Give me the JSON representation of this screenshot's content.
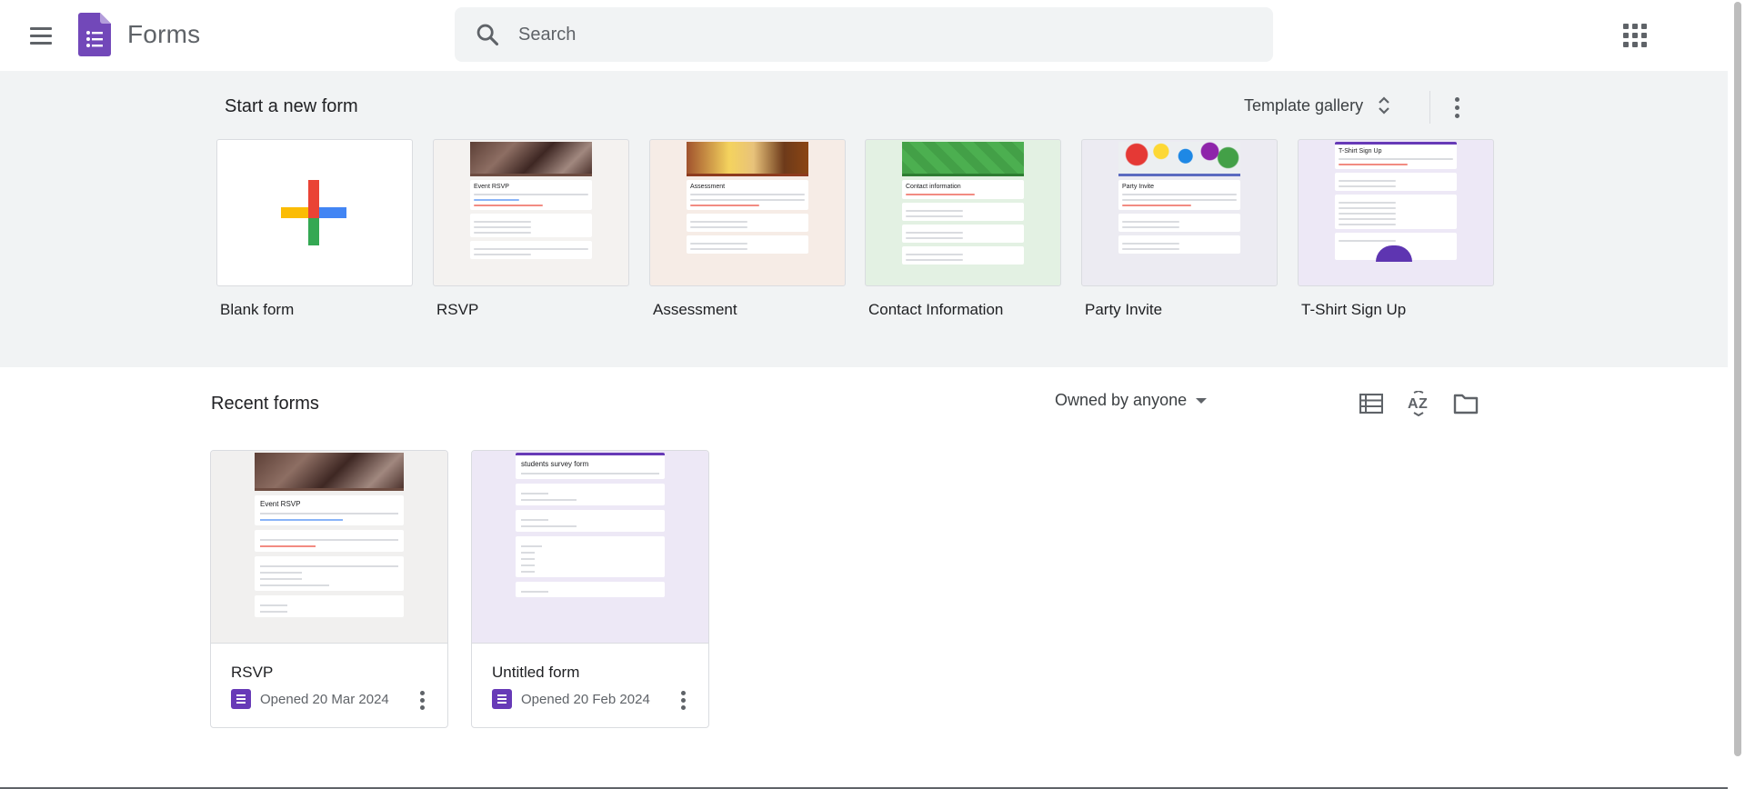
{
  "header": {
    "app_name": "Forms",
    "search_placeholder": "Search"
  },
  "templates_section": {
    "title": "Start a new form",
    "gallery_label": "Template gallery",
    "items": [
      {
        "label": "Blank form"
      },
      {
        "label": "RSVP",
        "preview_title": "Event RSVP"
      },
      {
        "label": "Assessment",
        "preview_title": "Assessment"
      },
      {
        "label": "Contact Information",
        "preview_title": "Contact information"
      },
      {
        "label": "Party Invite",
        "preview_title": "Party Invite"
      },
      {
        "label": "T-Shirt Sign Up",
        "preview_title": "T-Shirt Sign Up"
      }
    ]
  },
  "recent_section": {
    "title": "Recent forms",
    "owner_filter": "Owned by anyone",
    "forms": [
      {
        "title": "RSVP",
        "opened": "Opened 20 Mar 2024",
        "preview_title": "Event RSVP"
      },
      {
        "title": "Untitled form",
        "opened": "Opened 20 Feb 2024",
        "preview_title": "students survey form"
      }
    ]
  },
  "icons": {
    "menu": "hamburger-menu-icon",
    "logo": "forms-logo-icon",
    "search": "search-icon",
    "apps": "google-apps-icon",
    "unfold": "unfold-more-icon",
    "more": "more-vert-icon",
    "list_view": "list-view-icon",
    "sort": "sort-az-icon",
    "folder": "folder-icon"
  },
  "colors": {
    "brand_purple": "#673ab7",
    "band_bg": "#f1f3f4",
    "plus_red": "#ea4335",
    "plus_blue": "#4285f4",
    "plus_yellow": "#fbbc04",
    "plus_green": "#34a853"
  }
}
